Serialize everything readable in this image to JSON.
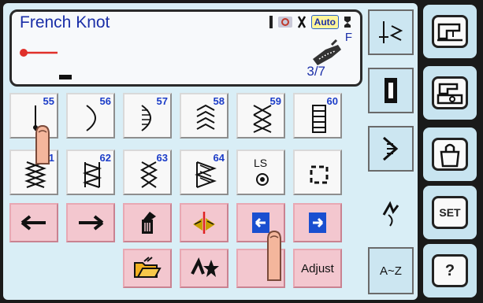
{
  "lcd": {
    "title": "French Knot",
    "auto_label": "Auto",
    "foot_letter": "F",
    "page": "3/7"
  },
  "stitches": [
    {
      "num": "55",
      "icon": "french-knot-icon"
    },
    {
      "num": "56",
      "icon": "scallop-icon"
    },
    {
      "num": "57",
      "icon": "satin-scallop-icon"
    },
    {
      "num": "58",
      "icon": "feather-stitch-icon"
    },
    {
      "num": "59",
      "icon": "cross-stitch-icon"
    },
    {
      "num": "60",
      "icon": "ladder-stitch-icon"
    },
    {
      "num": "61",
      "icon": "smocking-stitch-icon"
    },
    {
      "num": "62",
      "icon": "zigzag-band-icon"
    },
    {
      "num": "63",
      "icon": "honeycomb-stitch-icon"
    },
    {
      "num": "64",
      "icon": "herringbone-band-icon"
    },
    {
      "num": "",
      "icon": "ls-stitch-icon",
      "label": "LS"
    },
    {
      "num": "",
      "icon": "dashed-square-icon"
    }
  ],
  "tools": {
    "adjust_label": "Adjust",
    "az_label": "A~Z",
    "set_label": "SET",
    "help_label": "?"
  },
  "colors": {
    "title_blue": "#1b2fa8",
    "number_blue": "#1b3cc8",
    "pink_button": "#f3c7cf",
    "panel_blue": "#d9eef6"
  }
}
